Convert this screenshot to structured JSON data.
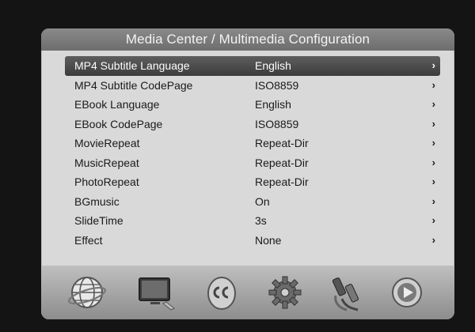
{
  "title": "Media Center / Multimedia Configuration",
  "menu": {
    "items": [
      {
        "label": "MP4 Subtitle Language",
        "value": "English"
      },
      {
        "label": "MP4 Subtitle CodePage",
        "value": "ISO8859"
      },
      {
        "label": "EBook Language",
        "value": "English"
      },
      {
        "label": "EBook CodePage",
        "value": "ISO8859"
      },
      {
        "label": "MovieRepeat",
        "value": "Repeat-Dir"
      },
      {
        "label": "MusicRepeat",
        "value": "Repeat-Dir"
      },
      {
        "label": "PhotoRepeat",
        "value": "Repeat-Dir"
      },
      {
        "label": "BGmusic",
        "value": "On"
      },
      {
        "label": "SlideTime",
        "value": "3s"
      },
      {
        "label": "Effect",
        "value": "None"
      }
    ],
    "chevron": "›",
    "selected_index": 0
  },
  "dock": {
    "icons": [
      "globe-icon",
      "monitor-icon",
      "subtitle-cc-icon",
      "gear-icon",
      "connector-cable-icon",
      "play-button-icon"
    ]
  },
  "colors": {
    "panel": "#d9d9d9",
    "title_bar": "#7c7c7c",
    "selected_row": "#4a4a4a",
    "background": "#141414"
  }
}
